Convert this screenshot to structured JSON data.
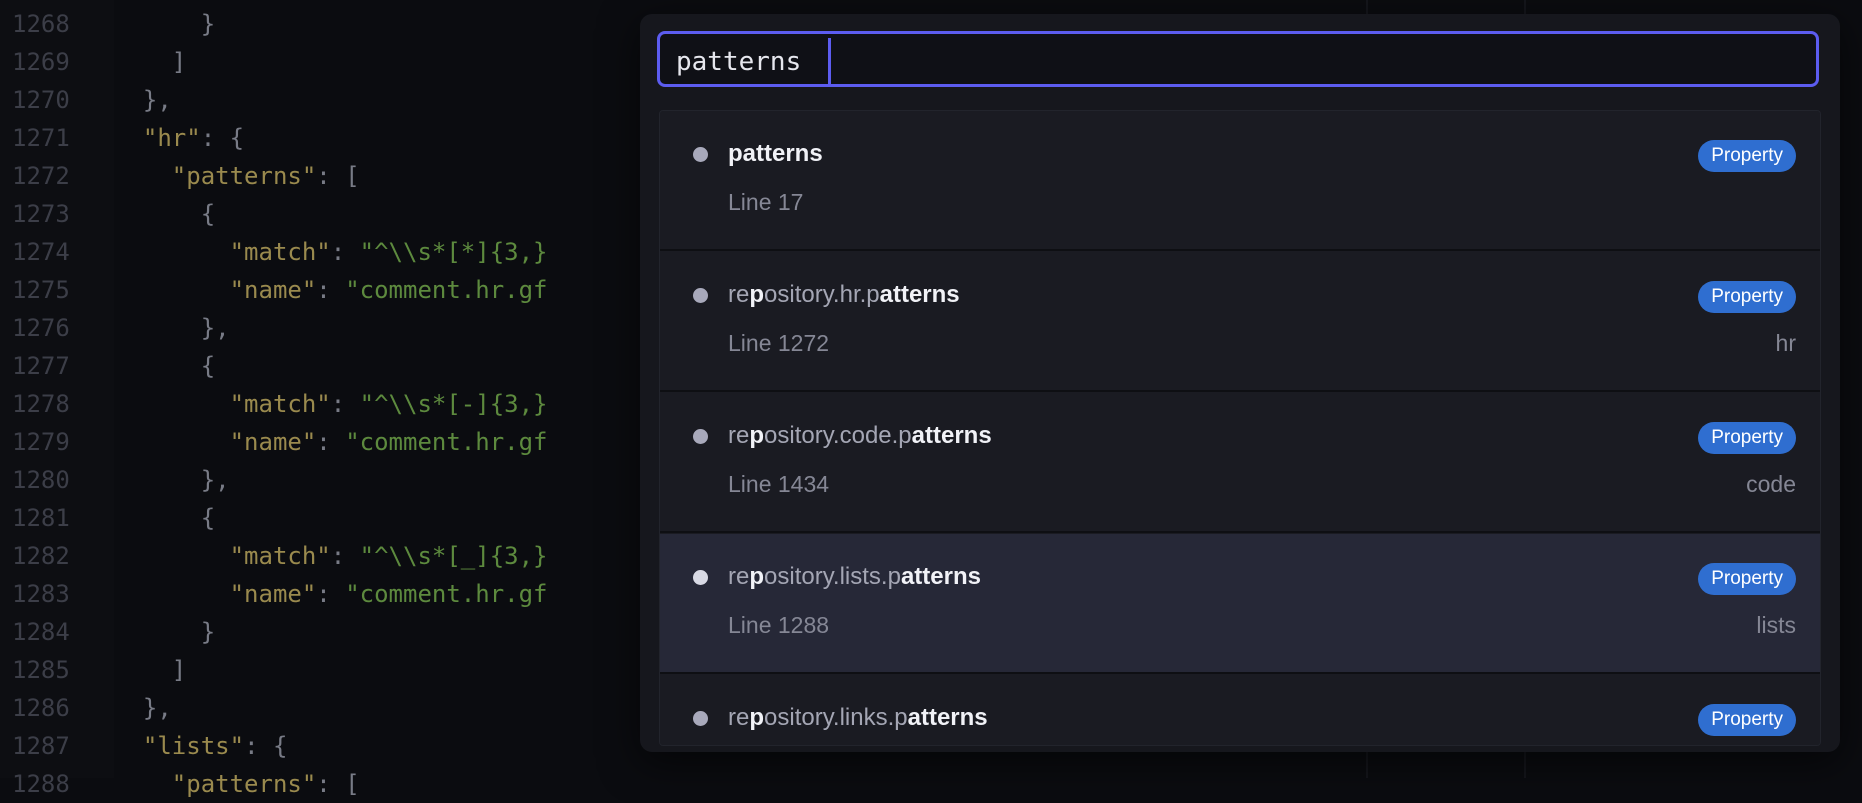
{
  "editor": {
    "lines": [
      {
        "num": "1268",
        "code": "      }"
      },
      {
        "num": "1269",
        "code": "    ]"
      },
      {
        "num": "1270",
        "code": "  },"
      },
      {
        "num": "1271",
        "code": "  \"hr\": {"
      },
      {
        "num": "1272",
        "code": "    \"patterns\": ["
      },
      {
        "num": "1273",
        "code": "      {"
      },
      {
        "num": "1274",
        "code": "        \"match\": \"^\\\\s*[*]{3,}"
      },
      {
        "num": "1275",
        "code": "        \"name\": \"comment.hr.gf"
      },
      {
        "num": "1276",
        "code": "      },"
      },
      {
        "num": "1277",
        "code": "      {"
      },
      {
        "num": "1278",
        "code": "        \"match\": \"^\\\\s*[-]{3,}"
      },
      {
        "num": "1279",
        "code": "        \"name\": \"comment.hr.gf"
      },
      {
        "num": "1280",
        "code": "      },"
      },
      {
        "num": "1281",
        "code": "      {"
      },
      {
        "num": "1282",
        "code": "        \"match\": \"^\\\\s*[_]{3,}"
      },
      {
        "num": "1283",
        "code": "        \"name\": \"comment.hr.gf"
      },
      {
        "num": "1284",
        "code": "      }"
      },
      {
        "num": "1285",
        "code": "    ]"
      },
      {
        "num": "1286",
        "code": "  },"
      },
      {
        "num": "1287",
        "code": "  \"lists\": {"
      },
      {
        "num": "1288",
        "code": "    \"patterns\": ["
      }
    ]
  },
  "palette": {
    "query": "patterns",
    "results": [
      {
        "title_parts": [
          {
            "t": "patterns",
            "m": true
          }
        ],
        "line": "Line 17",
        "scope": "",
        "badge": "Property"
      },
      {
        "title_parts": [
          {
            "t": "re",
            "m": false
          },
          {
            "t": "p",
            "m": true
          },
          {
            "t": "ository.hr.p",
            "m": false
          },
          {
            "t": "atterns",
            "m": true
          }
        ],
        "line": "Line 1272",
        "scope": "hr",
        "badge": "Property"
      },
      {
        "title_parts": [
          {
            "t": "re",
            "m": false
          },
          {
            "t": "p",
            "m": true
          },
          {
            "t": "ository.code.p",
            "m": false
          },
          {
            "t": "atterns",
            "m": true
          }
        ],
        "line": "Line 1434",
        "scope": "code",
        "badge": "Property"
      },
      {
        "title_parts": [
          {
            "t": "re",
            "m": false
          },
          {
            "t": "p",
            "m": true
          },
          {
            "t": "ository.lists.p",
            "m": false
          },
          {
            "t": "atterns",
            "m": true
          }
        ],
        "line": "Line 1288",
        "scope": "lists",
        "badge": "Property",
        "selected": true
      },
      {
        "title_parts": [
          {
            "t": "re",
            "m": false
          },
          {
            "t": "p",
            "m": true
          },
          {
            "t": "ository.links.p",
            "m": false
          },
          {
            "t": "atterns",
            "m": true
          }
        ],
        "line": "",
        "scope": "",
        "badge": "Property"
      }
    ]
  },
  "colors": {
    "accent": "#5c5cf0",
    "badge": "#2f6ed0",
    "background": "#0b0c10",
    "palette_bg": "#16171d",
    "selected_row": "#262837"
  }
}
